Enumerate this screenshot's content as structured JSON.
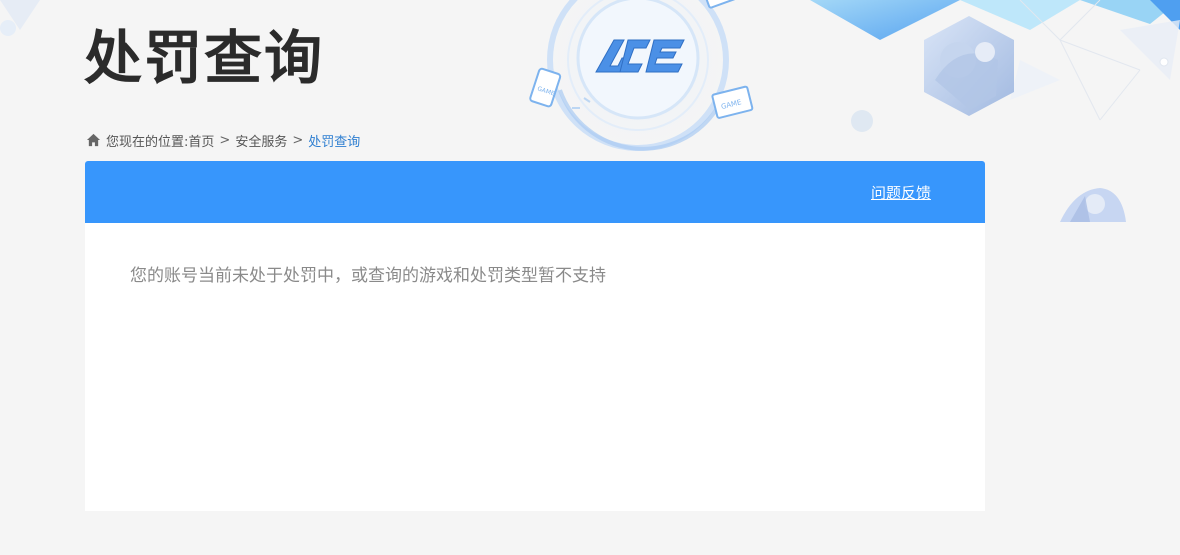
{
  "page": {
    "title": "处罚查询",
    "logo_text": "ACE"
  },
  "breadcrumb": {
    "prefix": "您现在的位置:",
    "items": [
      {
        "label": "首页"
      },
      {
        "label": "安全服务"
      },
      {
        "label": "处罚查询",
        "current": true
      }
    ],
    "separator": ">"
  },
  "panel": {
    "feedback_label": "问题反馈",
    "message": "您的账号当前未处于处罚中，或查询的游戏和处罚类型暂不支持"
  },
  "decor": {
    "badge_text": "GAME"
  },
  "colors": {
    "accent": "#3796fc",
    "breadcrumb_current": "#2f7fd1",
    "background": "#f5f5f5",
    "title": "#2b2b2b",
    "message": "#8a8a8a"
  }
}
